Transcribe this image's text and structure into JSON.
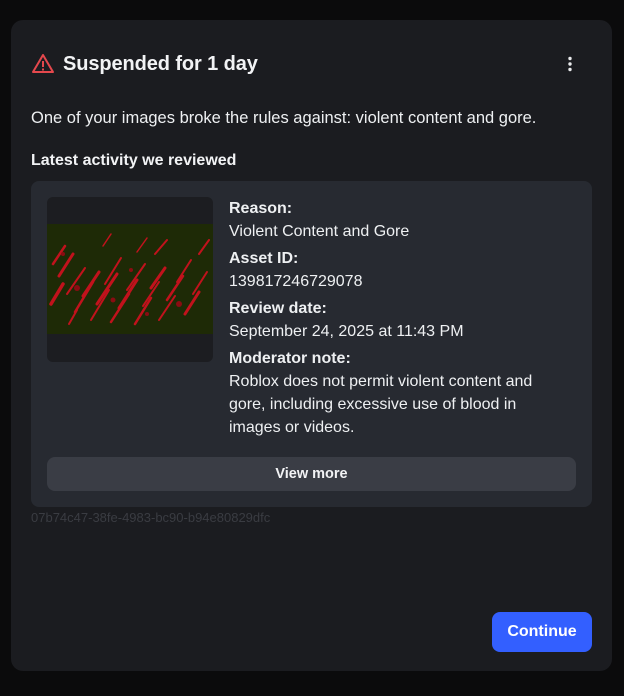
{
  "header": {
    "title": "Suspended for 1 day",
    "icon": "warning-triangle-icon",
    "menu_icon": "more-vertical-icon"
  },
  "message": "One of your images broke the rules against: violent content and gore.",
  "activity": {
    "section_label": "Latest activity we reviewed",
    "reason_label": "Reason:",
    "reason_value": "Violent Content and Gore",
    "asset_label": "Asset ID:",
    "asset_value": "139817246729078",
    "date_label": "Review date:",
    "date_value": "September 24, 2025 at 11:43 PM",
    "note_label": "Moderator note:",
    "note_value": "Roblox does not permit violent content and gore, including excessive use of blood in images or videos.",
    "view_more_label": "View more"
  },
  "request_id": "07b74c47-38fe-4983-bc90-b94e80829dfc",
  "footer": {
    "continue_label": "Continue"
  },
  "colors": {
    "accent": "#335fff",
    "warning": "#e5484d",
    "background": "#1b1c20",
    "card": "#272a31"
  }
}
